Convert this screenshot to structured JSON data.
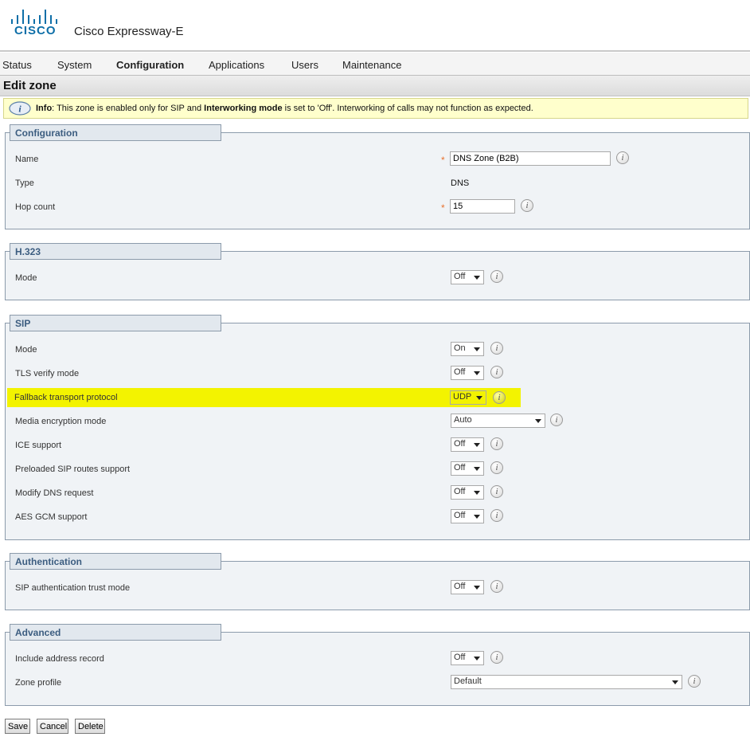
{
  "brand": {
    "logo_text": "CISCO",
    "product": "Cisco Expressway-E"
  },
  "nav": {
    "status": "Status",
    "system": "System",
    "configuration": "Configuration",
    "applications": "Applications",
    "users": "Users",
    "maintenance": "Maintenance",
    "active": "Configuration"
  },
  "page": {
    "title": "Edit zone"
  },
  "info": {
    "label": "Info",
    "text_1": ": This zone is enabled only for SIP and ",
    "bold_2": "Interworking mode",
    "text_3": " is set to 'Off'. Interworking of calls may not function as expected."
  },
  "sections": {
    "configuration": {
      "title": "Configuration",
      "name_label": "Name",
      "name_value": "DNS Zone (B2B)",
      "type_label": "Type",
      "type_value": "DNS",
      "hop_label": "Hop count",
      "hop_value": "15",
      "required_mark": "*"
    },
    "h323": {
      "title": "H.323",
      "mode_label": "Mode",
      "mode_value": "Off"
    },
    "sip": {
      "title": "SIP",
      "mode_label": "Mode",
      "mode_value": "On",
      "tls_label": "TLS verify mode",
      "tls_value": "Off",
      "fallback_label": "Fallback transport protocol",
      "fallback_value": "UDP",
      "media_label": "Media encryption mode",
      "media_value": "Auto",
      "ice_label": "ICE support",
      "ice_value": "Off",
      "preloaded_label": "Preloaded SIP routes support",
      "preloaded_value": "Off",
      "dns_label": "Modify DNS request",
      "dns_value": "Off",
      "aes_label": "AES GCM support",
      "aes_value": "Off"
    },
    "authentication": {
      "title": "Authentication",
      "trust_label": "SIP authentication trust mode",
      "trust_value": "Off"
    },
    "advanced": {
      "title": "Advanced",
      "address_label": "Include address record",
      "address_value": "Off",
      "profile_label": "Zone profile",
      "profile_value": "Default"
    }
  },
  "help_glyph": "i",
  "buttons": {
    "save": "Save",
    "cancel": "Cancel",
    "delete": "Delete"
  },
  "colors": {
    "highlight": "#f3f300",
    "section_title": "#3c5d80",
    "required": "#e8712e",
    "info_bg": "#ffffcc"
  },
  "icons": {
    "info": "info-icon",
    "help": "help-icon",
    "dropdown": "chevron-down-icon"
  }
}
